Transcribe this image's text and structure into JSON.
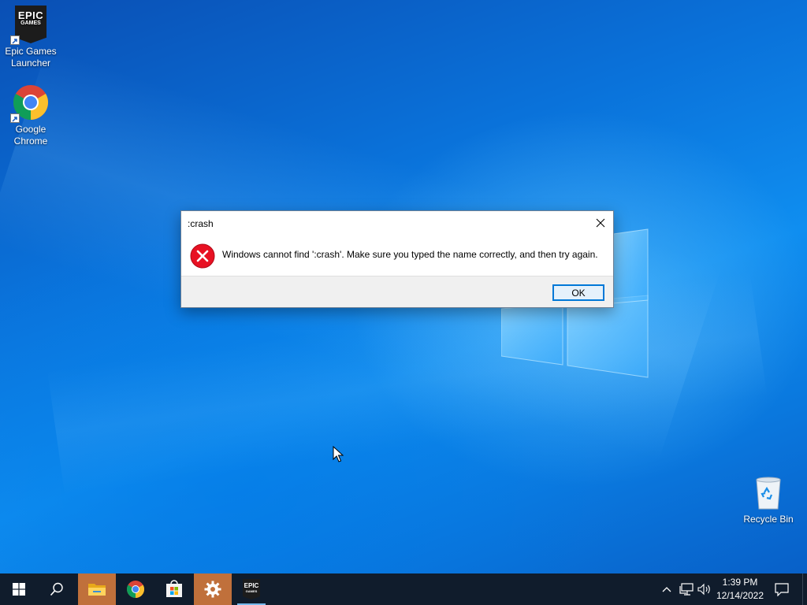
{
  "desktop": {
    "icons": [
      {
        "label_line1": "Epic Games",
        "label_line2": "Launcher",
        "icon": "epic-games-icon"
      },
      {
        "label_line1": "Google",
        "label_line2": "Chrome",
        "icon": "chrome-icon"
      },
      {
        "label_line1": "Recycle Bin",
        "label_line2": "",
        "icon": "recycle-bin-icon"
      }
    ],
    "epic_logo_top": "EPIC",
    "epic_logo_bottom": "GAMES"
  },
  "dialog": {
    "title": ":crash",
    "message": "Windows cannot find ':crash'. Make sure you typed the name correctly, and then try again.",
    "ok_label": "OK",
    "icon": "error-icon"
  },
  "taskbar": {
    "items": [
      {
        "name": "start",
        "icon": "windows-start-icon"
      },
      {
        "name": "search",
        "icon": "search-icon"
      },
      {
        "name": "file-explorer",
        "icon": "folder-icon",
        "state": "active"
      },
      {
        "name": "google-chrome",
        "icon": "chrome-icon"
      },
      {
        "name": "microsoft-store",
        "icon": "store-icon"
      },
      {
        "name": "settings",
        "icon": "gear-icon",
        "state": "active"
      },
      {
        "name": "epic-games",
        "icon": "epic-games-icon",
        "state": "running"
      }
    ],
    "epic_logo_top": "EPIC",
    "epic_logo_bottom": "GAMES",
    "tray": {
      "time": "1:39 PM",
      "date": "12/14/2022"
    }
  },
  "colors": {
    "taskbar_bg": "#101c2c",
    "active_app": "#c0703b",
    "accent": "#0078d7",
    "error_red": "#e81123"
  }
}
